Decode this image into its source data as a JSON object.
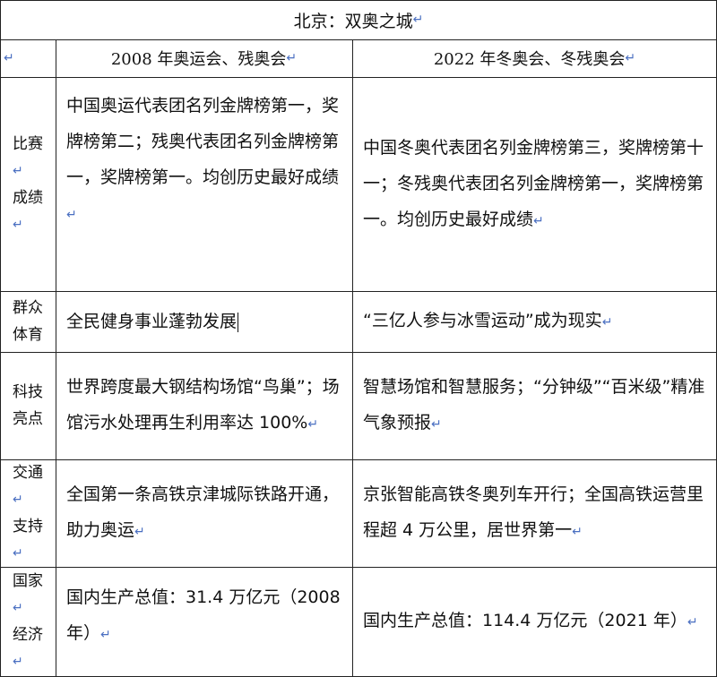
{
  "title": "北京：双奥之城",
  "header": {
    "col2008": "2008 年奥运会、残奥会",
    "col2022": "2022 年冬奥会、冬残奥会"
  },
  "rows": [
    {
      "label1": "比赛",
      "label2": "成绩",
      "c2008": "中国奥运代表团名列金牌榜第一，奖牌榜第二；残奥代表团名列金牌榜第一，奖牌榜第一。均创历史最好成绩",
      "c2022": "中国冬奥代表团名列金牌榜第三，奖牌榜第十一；冬残奥代表团名列金牌榜第一，奖牌榜第一。均创历史最好成绩"
    },
    {
      "label1": "群众",
      "label2": "体育",
      "c2008": "全民健身事业蓬勃发展",
      "c2022": "“三亿人参与冰雪运动”成为现实"
    },
    {
      "label1": "科技",
      "label2": "亮点",
      "c2008": "世界跨度最大钢结构场馆“鸟巢”；场馆污水处理再生利用率达 100%",
      "c2022": "智慧场馆和智慧服务；“分钟级”“百米级”精准气象预报"
    },
    {
      "label1": "交通",
      "label2": "支持",
      "c2008": "全国第一条高铁京津城际铁路开通，助力奥运",
      "c2022": "京张智能高铁冬奥列车开行；全国高铁运营里程超 4 万公里，居世界第一"
    },
    {
      "label1": "国家",
      "label2": "经济",
      "c2008": "国内生产总值：31.4 万亿元（2008 年）",
      "c2022": "国内生产总值：114.4 万亿元（2021 年）"
    }
  ]
}
